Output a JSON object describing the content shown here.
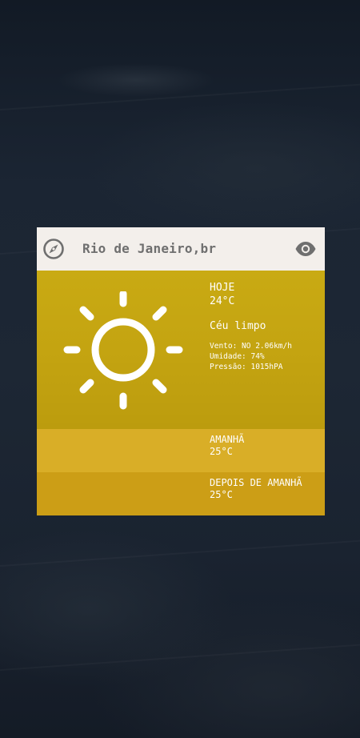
{
  "header": {
    "location": "Rio de Janeiro,br",
    "left_icon": "compass-icon",
    "right_icon": "eye-icon"
  },
  "today": {
    "label": "HOJE",
    "temperature": "24°C",
    "condition": "Céu limpo",
    "icon": "sun-icon",
    "wind": "Vento: NO 2.06km/h",
    "humidity": "Umidade: 74%",
    "pressure": "Pressão: 1015hPA",
    "color": "#c4a411"
  },
  "forecast": [
    {
      "label": "AMANHÃ",
      "temperature": "25°C",
      "color": "#d9ae27"
    },
    {
      "label": "DEPOIS DE AMANHÃ",
      "temperature": "25°C",
      "color": "#cc9e16"
    }
  ]
}
